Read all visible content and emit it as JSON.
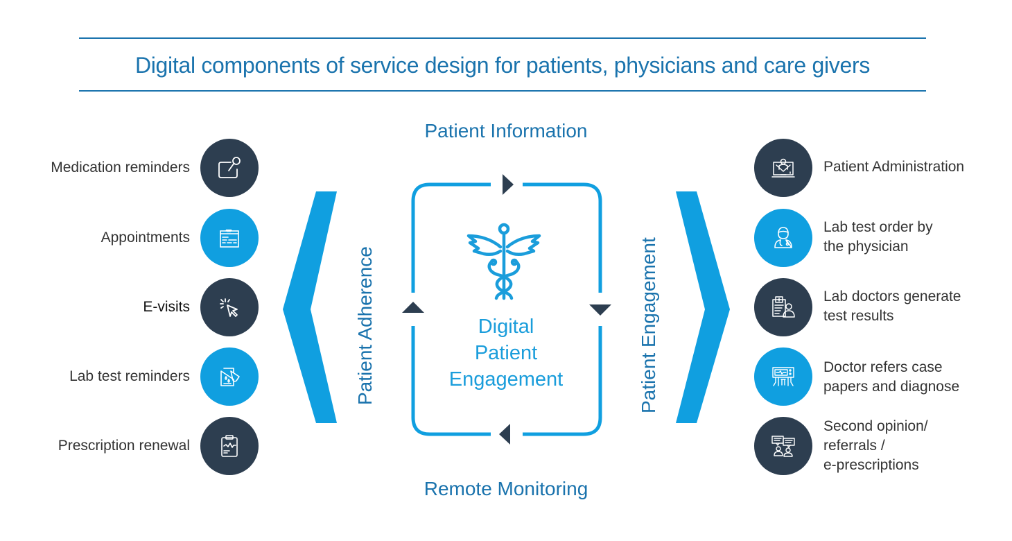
{
  "title": "Digital components of service design for patients, physicians and care givers",
  "colors": {
    "title_blue": "#1a73ad",
    "accent_blue": "#109fe0",
    "dark_navy": "#2d3e50",
    "text_dark": "#333333"
  },
  "cycle": {
    "top_label": "Patient Information",
    "bottom_label": "Remote Monitoring",
    "center_icon": "caduceus-icon",
    "center_lines": [
      "Digital",
      "Patient",
      "Engagement"
    ]
  },
  "left_column": {
    "vertical_label": "Patient Adherence",
    "bracket": "chevron-left",
    "items": [
      {
        "label": "Medication reminders",
        "icon": "pushpin-note-icon",
        "style": "dark"
      },
      {
        "label": "Appointments",
        "icon": "calendar-icon",
        "style": "blue"
      },
      {
        "label": "E-visits",
        "icon": "cursor-click-icon",
        "style": "dark"
      },
      {
        "label": "Lab test reminders",
        "icon": "lab-report-test-tube-icon",
        "style": "blue"
      },
      {
        "label": "Prescription renewal",
        "icon": "clipboard-ecg-icon",
        "style": "dark"
      }
    ]
  },
  "right_column": {
    "vertical_label": "Patient Engagement",
    "bracket": "chevron-right",
    "items": [
      {
        "lines": [
          "Patient Administration"
        ],
        "icon": "laptop-patient-icon",
        "style": "dark"
      },
      {
        "lines": [
          "Lab test order by",
          "the physician"
        ],
        "icon": "doctor-stethoscope-icon",
        "style": "blue"
      },
      {
        "lines": [
          "Lab doctors generate",
          "test results"
        ],
        "icon": "medical-record-doctor-icon",
        "style": "dark"
      },
      {
        "lines": [
          "Doctor refers case",
          "papers and diagnose"
        ],
        "icon": "monitor-consultation-icon",
        "style": "blue"
      },
      {
        "lines": [
          "Second opinion/",
          "referrals /",
          "e-prescriptions"
        ],
        "icon": "doctors-discussion-icon",
        "style": "dark"
      }
    ]
  }
}
